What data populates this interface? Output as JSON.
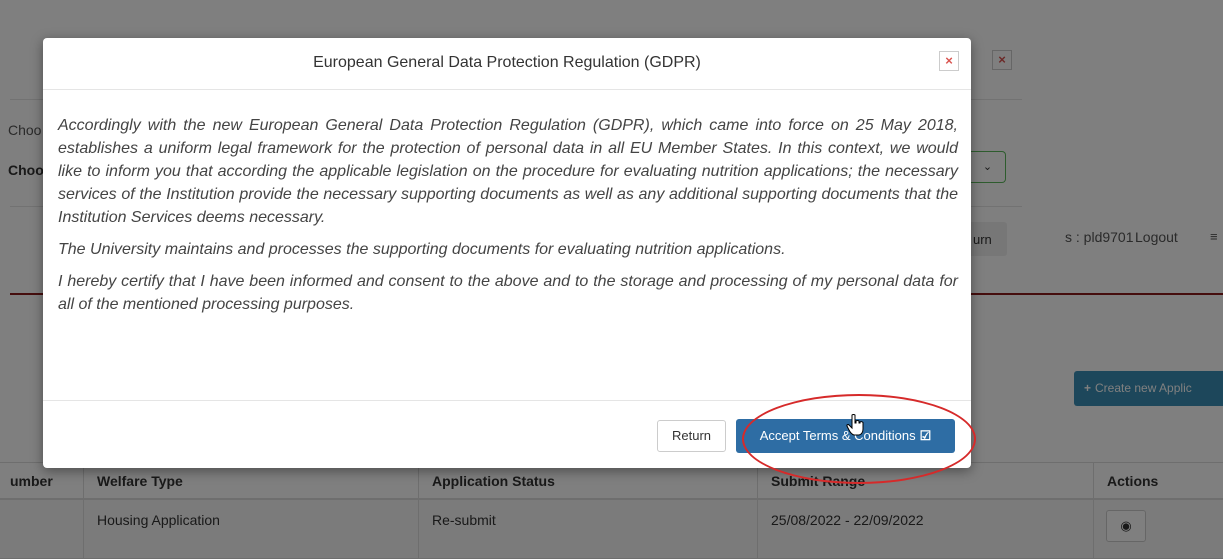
{
  "background": {
    "user_text": "s : pld9701",
    "logout": "Logout",
    "menu_icon": "menu-icon",
    "create_button": "Create new Applic",
    "back_modal": {
      "label_1": "Choo",
      "label_2": "Choo",
      "return": "urn"
    },
    "table": {
      "headers": [
        "umber",
        "Welfare Type",
        "Application Status",
        "Submit Range",
        "Actions"
      ],
      "rows": [
        {
          "welfare_type": "Housing Application",
          "status": "Re-submit",
          "submit_range": "25/08/2022 - 22/09/2022"
        }
      ]
    }
  },
  "modal": {
    "title": "European General Data Protection Regulation (GDPR)",
    "paragraphs": [
      "Accordingly with the new European General Data Protection Regulation  (GDPR), which came into force on 25 May 2018, establishes a uniform legal framework for the protection of personal data in all EU Member States. In this context, we would like to inform you that according the applicable legislation on the procedure for evaluating nutrition applications; the necessary services of the Institution provide the necessary supporting documents as well as any additional supporting documents that the Institution Services deems necessary.",
      "The University maintains and processes the supporting documents for evaluating nutrition applications.",
      "I hereby certify that I have been informed and consent to the above and to the storage and processing of my personal data for all of the mentioned processing purposes."
    ],
    "return_label": "Return",
    "accept_label": "Accept Terms & Conditions"
  },
  "colors": {
    "accept_button": "#2e6da4",
    "annotation_ellipse": "#d62a2a",
    "close_x": "#d9534f",
    "create_button": "#3a8fb7"
  }
}
